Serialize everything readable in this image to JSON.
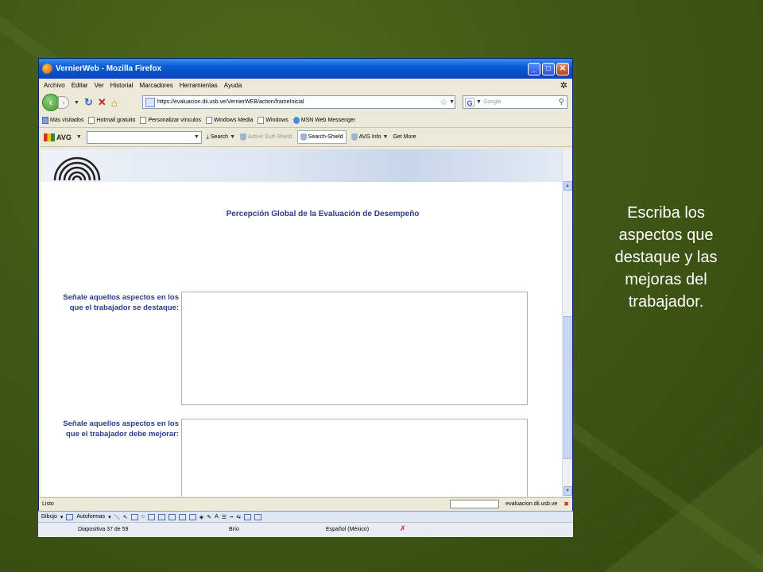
{
  "window": {
    "title": "VernierWeb - Mozilla Firefox"
  },
  "menu": [
    "Archivo",
    "Editar",
    "Ver",
    "Historial",
    "Marcadores",
    "Herramientas",
    "Ayuda"
  ],
  "navbar": {
    "url": "https://evaluacion.dii.usb.ve/VernierWEB/action/frameInicial",
    "search_placeholder": "Google"
  },
  "bookmarks": [
    "Más visitados",
    "Hotmail gratuito",
    "Personalizar vínculos",
    "Windows Media",
    "Windows",
    "MSN Web Messenger"
  ],
  "avg_toolbar": {
    "logo": "AVG",
    "search": "Search",
    "active_surf_shield": "Active Surf-Shield",
    "search_shield": "Search-Shield",
    "avg_info": "AVG Info",
    "get_more": "Get More"
  },
  "form": {
    "title": "Percepción Global de la Evaluación de Desempeño",
    "q1_line1": "Señale aquellos aspectos en los",
    "q1_line2": "que el trabajador se destaque:",
    "q1_value": "",
    "q2_line1": "Señale aquellos aspectos en los",
    "q2_line2": "que el trabajador debe mejorar:",
    "q2_value": ""
  },
  "status": {
    "text": "Listo",
    "domain": "evaluacion.dii.usb.ve"
  },
  "ppt": {
    "draw_label": "Dibujo",
    "autoshapes_label": "Autoformas",
    "slide_info": "Diapositiva 37 de 59",
    "design": "Brío",
    "language": "Español (México)"
  },
  "caption": {
    "line1": "Escriba los",
    "line2": "aspectos que",
    "line3": "destaque y las",
    "line4": "mejoras del",
    "line5": "trabajador."
  },
  "colors": {
    "background": "#3f5816",
    "form_text": "#2c3a8c",
    "titlebar": "#0a5ad6"
  }
}
